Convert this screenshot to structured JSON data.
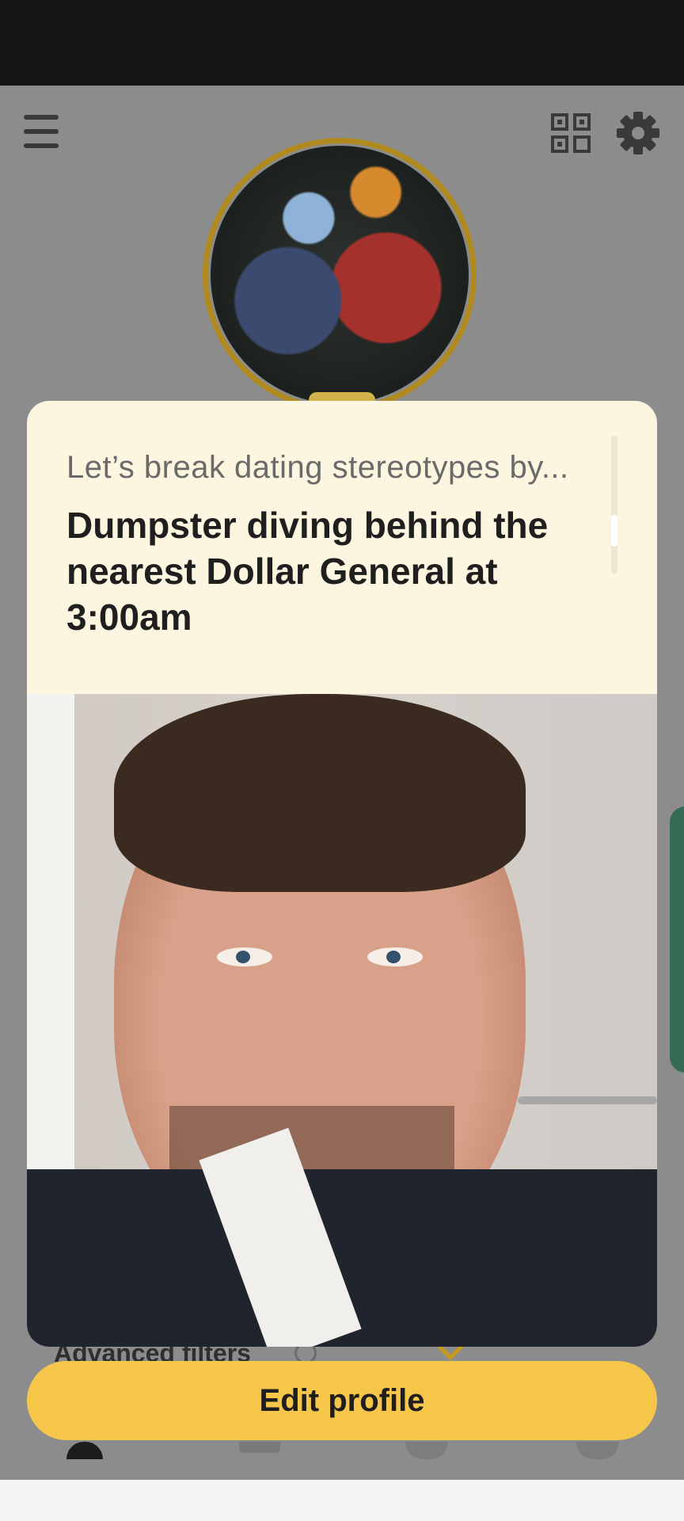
{
  "header": {
    "menu_icon": "menu-icon",
    "qr_icon": "qr-code-icon",
    "settings_icon": "gear-icon"
  },
  "profile": {
    "avatar": "profile-photo",
    "accent_color": "#b08a1f"
  },
  "card": {
    "prompt_label": "Let’s break dating stereotypes by...",
    "prompt_answer": "Dumpster diving behind the nearest Dollar General at 3:00am",
    "background_color": "#fcf6e0",
    "photo": "selfie-photo"
  },
  "background": {
    "filters_label": "Advanced filters",
    "filters_icon": "info-icon",
    "filters_check_icon": "check-icon"
  },
  "actions": {
    "edit_profile_label": "Edit profile",
    "button_color": "#f6c64a"
  },
  "bottom_nav": {
    "tabs": [
      "profile-tab",
      "discover-tab",
      "people-tab",
      "chats-tab"
    ]
  }
}
